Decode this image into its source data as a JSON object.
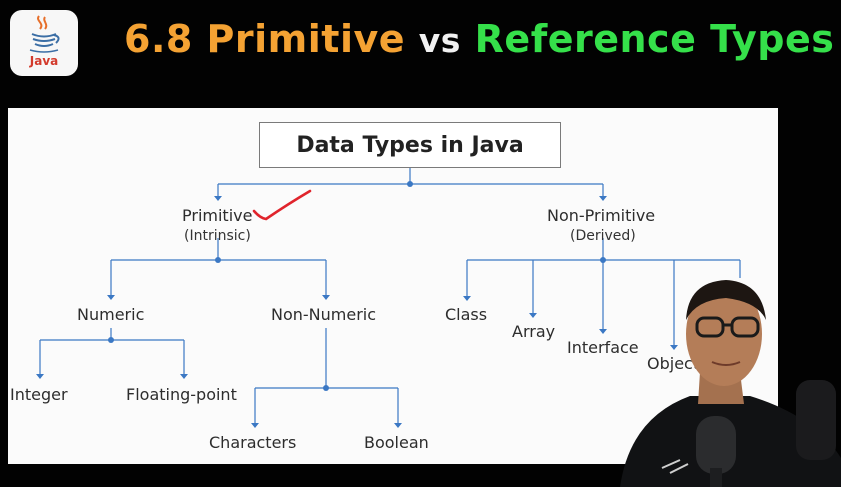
{
  "logo": {
    "text": "Java",
    "icon": "java-coffee-cup-icon"
  },
  "title": {
    "part1": "6.8 Primitive",
    "part2": "vs",
    "part3": "Reference Types"
  },
  "diagram": {
    "root": "Data Types in Java",
    "primitive": {
      "label": "Primitive",
      "sub": "(Intrinsic)"
    },
    "non_primitive": {
      "label": "Non-Primitive",
      "sub": "(Derived)"
    },
    "numeric": "Numeric",
    "non_numeric": "Non-Numeric",
    "integer": "Integer",
    "floating_point": "Floating-point",
    "characters": "Characters",
    "boolean": "Boolean",
    "class": "Class",
    "array": "Array",
    "interface": "Interface",
    "object": "Object"
  },
  "annotation": {
    "icon": "red-checkmark-icon",
    "color": "#e0242c"
  },
  "colors": {
    "title_orange": "#f4a233",
    "title_white": "#f2f2f2",
    "title_green": "#35e04a",
    "connector_blue": "#3b78c4"
  }
}
